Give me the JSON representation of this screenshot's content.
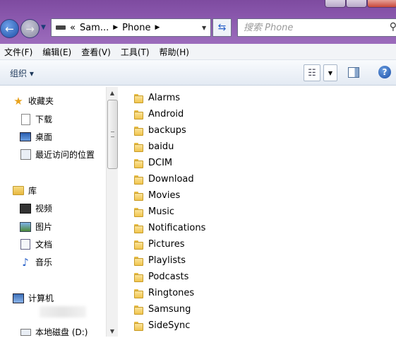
{
  "address_bar": {
    "overflow": "«",
    "segments": [
      "Sam...",
      "Phone"
    ]
  },
  "search": {
    "placeholder": "搜索 Phone"
  },
  "menubar": [
    "文件(F)",
    "编辑(E)",
    "查看(V)",
    "工具(T)",
    "帮助(H)"
  ],
  "commandbar": {
    "organize_label": "组织 ▾"
  },
  "navpane": {
    "favorites": {
      "label": "收藏夹",
      "items": [
        "下载",
        "桌面",
        "最近访问的位置"
      ]
    },
    "libraries": {
      "label": "库",
      "items": [
        "视频",
        "图片",
        "文档",
        "音乐"
      ]
    },
    "computer": {
      "label": "计算机",
      "drive": "本地磁盘 (D:)"
    }
  },
  "folders": [
    "Alarms",
    "Android",
    "backups",
    "baidu",
    "DCIM",
    "Download",
    "Movies",
    "Music",
    "Notifications",
    "Pictures",
    "Playlists",
    "Podcasts",
    "Ringtones",
    "Samsung",
    "SideSync"
  ],
  "colors": {
    "titlebar": "#8a58ad",
    "folder": "#f1c54e"
  }
}
